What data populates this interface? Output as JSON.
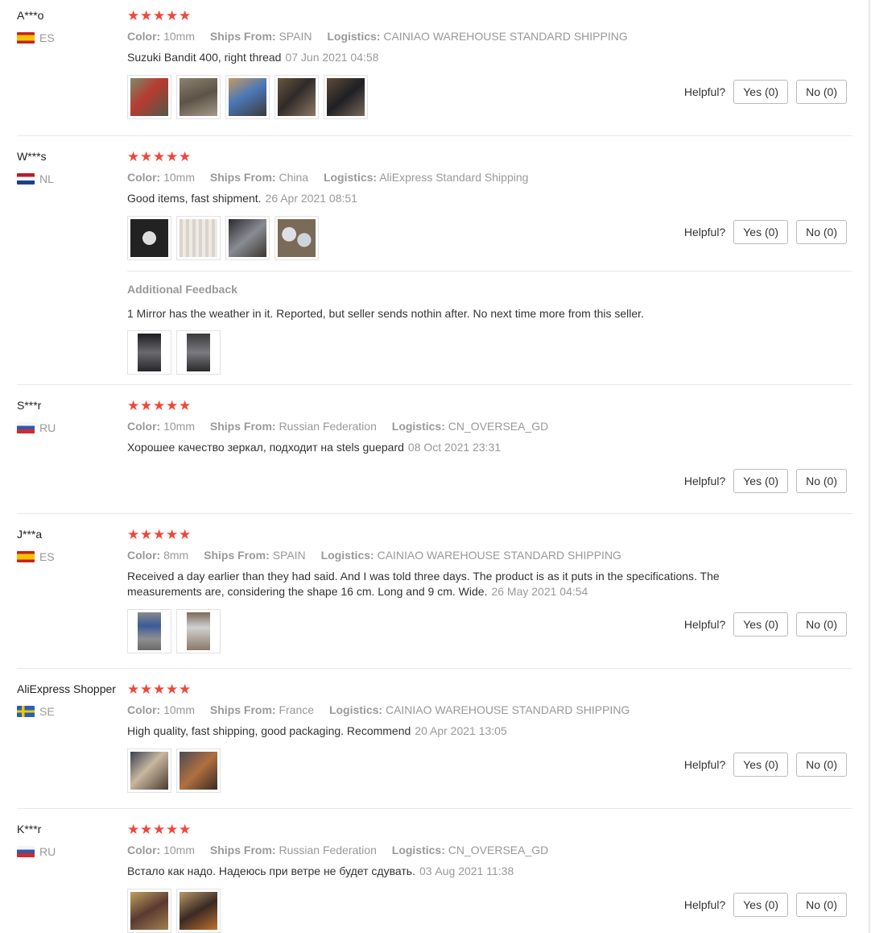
{
  "labels": {
    "color": "Color:",
    "ships_from": "Ships From:",
    "logistics": "Logistics:",
    "helpful": "Helpful?",
    "yes": "Yes (0)",
    "no": "No (0)",
    "additional_feedback": "Additional Feedback"
  },
  "colors": {
    "star": "#f0473a",
    "muted": "#999999",
    "text": "#333333"
  },
  "reviews": [
    {
      "user": "A***o",
      "country": "ES",
      "rating": 5,
      "color": "10mm",
      "ships_from": "SPAIN",
      "logistics": "CAINIAO WAREHOUSE STANDARD SHIPPING",
      "text": "Suzuki Bandit 400, right thread",
      "date": "07 Jun 2021 04:58",
      "photos": 5
    },
    {
      "user": "W***s",
      "country": "NL",
      "rating": 5,
      "color": "10mm",
      "ships_from": "China",
      "logistics": "AliExpress Standard Shipping",
      "text": "Good items, fast shipment.",
      "date": "26 Apr 2021 08:51",
      "photos": 4,
      "additional": {
        "text": "1 Mirror has the weather in it. Reported, but seller sends nothin after. No next time more from this seller.",
        "photos": 2
      }
    },
    {
      "user": "S***r",
      "country": "RU",
      "rating": 5,
      "color": "10mm",
      "ships_from": "Russian Federation",
      "logistics": "CN_OVERSEA_GD",
      "text": "Хорошее качество зеркал, подходит на stels guepard",
      "date": "08 Oct 2021 23:31",
      "photos": 0
    },
    {
      "user": "J***a",
      "country": "ES",
      "rating": 5,
      "color": "8mm",
      "ships_from": "SPAIN",
      "logistics": "CAINIAO WAREHOUSE STANDARD SHIPPING",
      "text": "Received a day earlier than they had said. And I was told three days. The product is as it puts in the specifications. The measurements are, considering the shape 16 cm. Long and 9 cm. Wide.",
      "date": "26 May 2021 04:54",
      "photos": 2
    },
    {
      "user": "AliExpress Shopper",
      "country": "SE",
      "rating": 5,
      "color": "10mm",
      "ships_from": "France",
      "logistics": "CAINIAO WAREHOUSE STANDARD SHIPPING",
      "text": "High quality, fast shipping, good packaging. Recommend",
      "date": "20 Apr 2021 13:05",
      "photos": 2
    },
    {
      "user": "K***r",
      "country": "RU",
      "rating": 5,
      "color": "10mm",
      "ships_from": "Russian Federation",
      "logistics": "CN_OVERSEA_GD",
      "text": "Встало как надо. Надеюсь при ветре не будет сдувать.",
      "date": "03 Aug 2021 11:38",
      "photos": 2
    }
  ]
}
